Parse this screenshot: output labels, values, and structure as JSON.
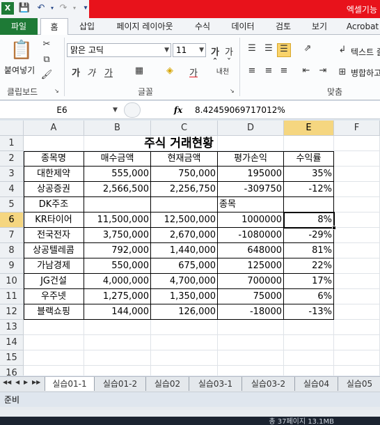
{
  "app": {
    "title": "엑셀기능",
    "quick_access": [
      "excel-icon",
      "save-icon",
      "undo-icon",
      "redo-icon",
      "customize-icon"
    ]
  },
  "ribbon_tabs": [
    "파일",
    "홈",
    "삽입",
    "페이지 레이아웃",
    "수식",
    "데이터",
    "검토",
    "보기",
    "Acrobat"
  ],
  "ribbon": {
    "paste_label": "붙여넣기",
    "font_name": "맑은 고딕",
    "font_size": "11",
    "wrap_text_label": "텍스트 줄",
    "merge_label": "병합하고",
    "groups": {
      "clipboard": "클립보드",
      "font": "글꼴",
      "alignment": "맞춤"
    }
  },
  "formula_bar": {
    "name_box": "E6",
    "fx": "fx",
    "formula": "8.42459069717012%"
  },
  "columns": [
    "A",
    "B",
    "C",
    "D",
    "E",
    "F"
  ],
  "rows": [
    "1",
    "2",
    "3",
    "4",
    "5",
    "6",
    "7",
    "8",
    "9",
    "10",
    "11",
    "12",
    "13",
    "14",
    "15",
    "16"
  ],
  "sheet": {
    "title": "주식 거래현황",
    "headers": [
      "종목명",
      "매수금액",
      "현재금액",
      "평가손익",
      "수익률"
    ],
    "data": [
      [
        "대한제약",
        "555,000",
        "750,000",
        "195000",
        "35%"
      ],
      [
        "상공증권",
        "2,566,500",
        "2,256,750",
        "-309750",
        "-12%"
      ],
      [
        "DK주조",
        "",
        "",
        "종목",
        ""
      ],
      [
        "KR타이어",
        "11,500,000",
        "12,500,000",
        "1000000",
        "8%"
      ],
      [
        "전국전자",
        "3,750,000",
        "2,670,000",
        "-1080000",
        "-29%"
      ],
      [
        "상공텔레콤",
        "792,000",
        "1,440,000",
        "648000",
        "81%"
      ],
      [
        "가남경제",
        "550,000",
        "675,000",
        "125000",
        "22%"
      ],
      [
        "JG건설",
        "4,000,000",
        "4,700,000",
        "700000",
        "17%"
      ],
      [
        "우주넷",
        "1,275,000",
        "1,350,000",
        "75000",
        "6%"
      ],
      [
        "블랙쇼핑",
        "144,000",
        "126,000",
        "-18000",
        "-13%"
      ]
    ],
    "active_cell": "E6"
  },
  "sheet_tabs": [
    "실습01-1",
    "실습01-2",
    "실습02",
    "실습03-1",
    "실습03-2",
    "실습04",
    "실습05"
  ],
  "active_sheet": "실습01-1",
  "status": {
    "ready": "준비"
  },
  "taskbar": {
    "info": "총 37페이지  13.1MB"
  }
}
